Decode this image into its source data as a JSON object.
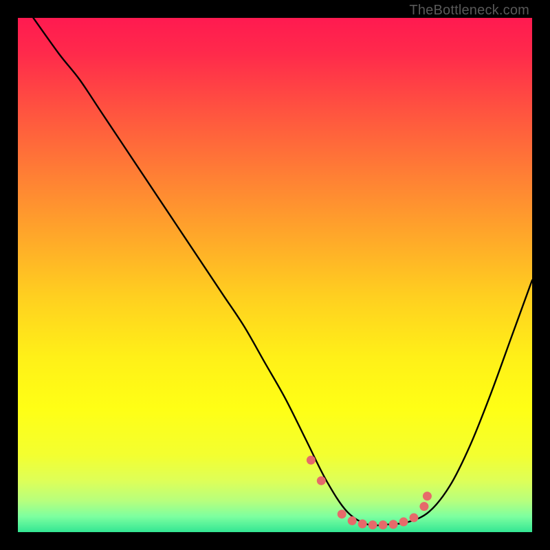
{
  "watermark": "TheBottleneck.com",
  "chart_data": {
    "type": "line",
    "title": "",
    "xlabel": "",
    "ylabel": "",
    "xlim": [
      0,
      100
    ],
    "ylim": [
      0,
      100
    ],
    "series": [
      {
        "name": "bottleneck-curve",
        "color": "#000000",
        "x": [
          3,
          8,
          12,
          16,
          20,
          24,
          28,
          32,
          36,
          40,
          44,
          48,
          52,
          56,
          60,
          64,
          68,
          72,
          76,
          80,
          84,
          88,
          92,
          96,
          100
        ],
        "y": [
          100,
          93,
          88,
          82,
          76,
          70,
          64,
          58,
          52,
          46,
          40,
          33,
          26,
          18,
          10,
          4,
          1.5,
          1.5,
          2,
          4,
          9,
          17,
          27,
          38,
          49
        ]
      }
    ],
    "markers": {
      "name": "highlight-dots",
      "color": "#e66a6a",
      "points": [
        {
          "x": 57,
          "y": 14
        },
        {
          "x": 59,
          "y": 10
        },
        {
          "x": 63,
          "y": 3.5
        },
        {
          "x": 65,
          "y": 2.2
        },
        {
          "x": 67,
          "y": 1.6
        },
        {
          "x": 69,
          "y": 1.4
        },
        {
          "x": 71,
          "y": 1.4
        },
        {
          "x": 73,
          "y": 1.5
        },
        {
          "x": 75,
          "y": 2.0
        },
        {
          "x": 77,
          "y": 2.8
        },
        {
          "x": 79,
          "y": 5.0
        },
        {
          "x": 79.6,
          "y": 7.0
        }
      ]
    },
    "background_gradient": {
      "stops": [
        {
          "offset": 0.0,
          "color": "#ff1a50"
        },
        {
          "offset": 0.07,
          "color": "#ff2a4b"
        },
        {
          "offset": 0.18,
          "color": "#ff5340"
        },
        {
          "offset": 0.3,
          "color": "#ff7d35"
        },
        {
          "offset": 0.42,
          "color": "#ffa62a"
        },
        {
          "offset": 0.54,
          "color": "#ffcf20"
        },
        {
          "offset": 0.66,
          "color": "#fff018"
        },
        {
          "offset": 0.76,
          "color": "#ffff15"
        },
        {
          "offset": 0.85,
          "color": "#f3ff30"
        },
        {
          "offset": 0.9,
          "color": "#deff58"
        },
        {
          "offset": 0.94,
          "color": "#b6ff7e"
        },
        {
          "offset": 0.97,
          "color": "#7cffa0"
        },
        {
          "offset": 1.0,
          "color": "#33e693"
        }
      ]
    }
  }
}
